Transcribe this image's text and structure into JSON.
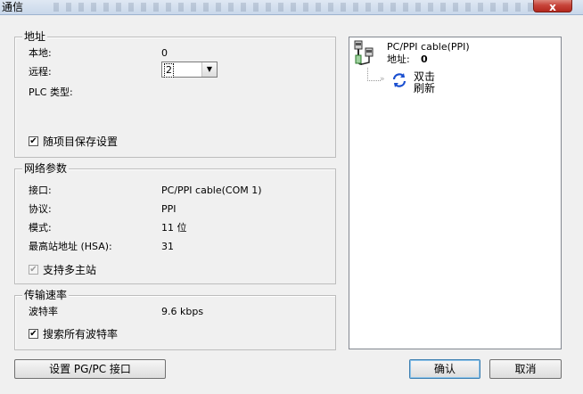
{
  "window": {
    "title": "通信",
    "close_glyph": "x"
  },
  "address": {
    "legend": "地址",
    "local_label": "本地:",
    "local_value": "0",
    "remote_label": "远程:",
    "remote_value": "2",
    "plc_type_label": "PLC 类型:",
    "save_with_project_label": "随项目保存设置",
    "save_with_project_checked": true
  },
  "network": {
    "legend": "网络参数",
    "interface_label": "接口:",
    "interface_value": "PC/PPI cable(COM 1)",
    "protocol_label": "协议:",
    "protocol_value": "PPI",
    "mode_label": "模式:",
    "mode_value": "11 位",
    "hsa_label": "最高站地址 (HSA):",
    "hsa_value": "31",
    "multi_master_label": "支持多主站",
    "multi_master_checked": true
  },
  "baud": {
    "legend": "传输速率",
    "rate_label": "波特率",
    "rate_value": "9.6 kbps",
    "search_all_label": "搜索所有波特率",
    "search_all_checked": true
  },
  "tree": {
    "cable_name": "PC/PPI cable(PPI)",
    "address_label": "地址:",
    "address_value": "0",
    "refresh_line1": "双击",
    "refresh_line2": "刷新"
  },
  "buttons": {
    "set_pgpc": "设置 PG/PC 接口",
    "ok": "确认",
    "cancel": "取消"
  },
  "check_glyph": "✔",
  "combo_arrow_glyph": "▼"
}
